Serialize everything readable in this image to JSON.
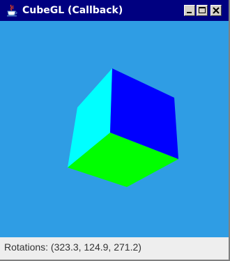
{
  "window": {
    "title": "CubeGL (Callback)"
  },
  "titlebar_buttons": {
    "minimize": "minimize-icon",
    "maximize": "maximize-icon",
    "close": "close-icon"
  },
  "canvas": {
    "background_color": "#2f9de4",
    "cube_face_colors": {
      "left": "#00ffff",
      "right": "#0000ff",
      "bottom": "#00ff00"
    }
  },
  "status": {
    "text": "Rotations: (323.3, 124.9, 271.2)"
  },
  "colors": {
    "titlebar": "#000080",
    "window_frame": "#d4d0c8"
  }
}
